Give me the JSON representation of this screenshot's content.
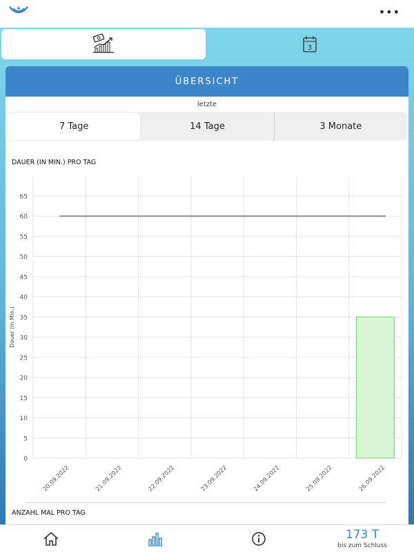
{
  "header": {
    "more_label": "•••"
  },
  "tabs": [
    {
      "name": "statistics",
      "icon": "money-chart-icon",
      "active": true
    },
    {
      "name": "calendar",
      "icon": "calendar-icon",
      "calendar_day": "3"
    }
  ],
  "overview": {
    "title": "ÜBERSICHT",
    "period_label": "letzte",
    "periods": [
      "7 Tage",
      "14 Tage",
      "3 Monate"
    ],
    "selected_period": "7 Tage"
  },
  "duration_section": {
    "title": "DAUER (IN MIN.) PRO TAG"
  },
  "count_section": {
    "title": "ANZAHL MAL PRO TAG"
  },
  "chart_data": {
    "type": "bar",
    "title": "DAUER (IN MIN.) PRO TAG",
    "ylabel": "Dauer (in Min.)",
    "xlabel": "",
    "categories": [
      "20.09.2022",
      "21.09.2022",
      "22.09.2022",
      "23.09.2022",
      "24.09.2022",
      "25.09.2022",
      "26.09.2022"
    ],
    "values": [
      0,
      0,
      0,
      0,
      0,
      0,
      35
    ],
    "target_line": 60,
    "ylim": [
      0,
      65
    ],
    "yticks": [
      0,
      5,
      10,
      15,
      20,
      25,
      30,
      35,
      40,
      45,
      50,
      55,
      60,
      65
    ],
    "grid": true,
    "bar_color": "#d8f5d4",
    "bar_border": "#6fd26b",
    "line_color": "#8a8a8a"
  },
  "footer": {
    "days_value": "173 T",
    "days_label": "bis zum Schluss"
  },
  "colors": {
    "header_blue": "#3a86c8",
    "accent_blue": "#3a86c8"
  }
}
